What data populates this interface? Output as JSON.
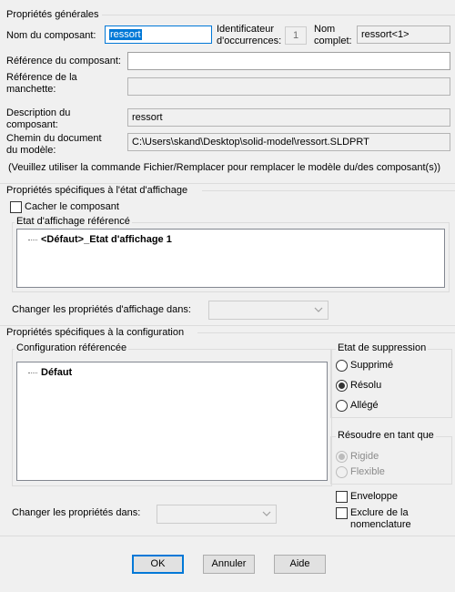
{
  "general": {
    "title": "Propriétés générales",
    "component_name_label": "Nom du composant:",
    "component_name_value": "ressort",
    "instance_id_label_1": "Identificateur",
    "instance_id_label_2": "d'occurrences:",
    "instance_id_value": "1",
    "full_name_label_1": "Nom",
    "full_name_label_2": "complet:",
    "full_name_value": "ressort<1>",
    "component_ref_label": "Référence du composant:",
    "component_ref_value": "",
    "sleeve_ref_label_1": "Référence de la",
    "sleeve_ref_label_2": "manchette:",
    "sleeve_ref_value": "",
    "description_label_1": "Description du",
    "description_label_2": "composant:",
    "description_value": "ressort",
    "model_path_label_1": "Chemin du document",
    "model_path_label_2": "du modèle:",
    "model_path_value": "C:\\Users\\skand\\Desktop\\solid-model\\ressort.SLDPRT",
    "note": "(Veuillez utiliser la commande Fichier/Remplacer pour remplacer le modèle du/des composant(s))"
  },
  "display_state": {
    "title": "Propriétés spécifiques à l'état d'affichage",
    "hide_component_label": "Cacher le composant",
    "hide_component_checked": false,
    "referenced_title": "Etat d'affichage référencé",
    "items": [
      "<Défaut>_Etat d'affichage 1"
    ],
    "change_label": "Changer les propriétés d'affichage dans:",
    "change_value": ""
  },
  "configuration": {
    "title": "Propriétés spécifiques à la configuration",
    "referenced_title": "Configuration référencée",
    "items": [
      "Défaut"
    ],
    "change_label": "Changer les propriétés dans:",
    "change_value": "",
    "suppression": {
      "title": "Etat de suppression",
      "options": [
        "Supprimé",
        "Résolu",
        "Allégé"
      ],
      "selected": "Résolu"
    },
    "solve_as": {
      "title": "Résoudre en tant que",
      "options": [
        "Rigide",
        "Flexible"
      ],
      "selected": "Rigide",
      "enabled": false
    },
    "envelope_label": "Enveloppe",
    "exclude_bom_label_1": "Exclure de la",
    "exclude_bom_label_2": "nomenclature"
  },
  "buttons": {
    "ok": "OK",
    "cancel": "Annuler",
    "help": "Aide"
  }
}
